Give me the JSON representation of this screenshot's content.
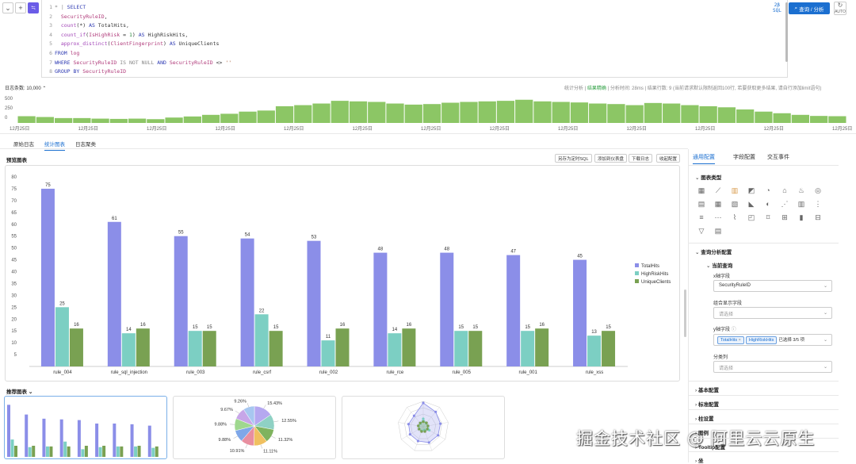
{
  "toolbar": {
    "collapse_icon": "chevron-down-icon",
    "add_icon": "plus-icon",
    "format_icon": "format-icon"
  },
  "editor": {
    "lines": [
      {
        "n": "1",
        "html_kind": "select",
        "text": "SELECT"
      },
      {
        "n": "2",
        "text": "SecurityRuleID,"
      },
      {
        "n": "3",
        "text": "count(*) AS TotalHits,"
      },
      {
        "n": "4",
        "text": "count_if(IsHighRisk = 1) AS HighRiskHits,"
      },
      {
        "n": "5",
        "text": "approx_distinct(ClientFingerprint) AS UniqueClients"
      },
      {
        "n": "6",
        "text": "FROM log"
      },
      {
        "n": "7",
        "text": "WHERE SecurityRuleID IS NOT NULL AND SecurityRuleID <> ''"
      },
      {
        "n": "8",
        "text": "GROUP BY SecurityRuleID"
      }
    ],
    "line1_prefix": "* |",
    "sql_badge_top": "2β",
    "sql_badge_bottom": "SQL"
  },
  "run_button": "查询 / 分析",
  "auto_label": "AUTO",
  "stats": {
    "log_count_label": "日志条数:",
    "log_count_value": "10,000",
    "right": "统计分析  |  结果精确  |  分析时间: 28ms  |  结果行数: 9 (当前请求默认限制返回100行, 若要获取更多结果, 请自行添加limit语句)",
    "right_accent": "结果精确"
  },
  "histogram": {
    "y_ticks": [
      "500",
      "250",
      "0"
    ],
    "x_labels": [
      "12月25日",
      "12月25日",
      "12月25日",
      "12月25日",
      "12月25日",
      "12月25日",
      "12月25日",
      "12月25日",
      "12月25日",
      "12月25日",
      "12月25日",
      "12月25日",
      "12月25日"
    ],
    "values": [
      0.25,
      0.22,
      0.18,
      0.18,
      0.16,
      0.15,
      0.16,
      0.14,
      0.2,
      0.24,
      0.3,
      0.34,
      0.42,
      0.46,
      0.62,
      0.66,
      0.72,
      0.82,
      0.8,
      0.78,
      0.72,
      0.68,
      0.7,
      0.75,
      0.78,
      0.8,
      0.82,
      0.86,
      0.8,
      0.78,
      0.76,
      0.72,
      0.7,
      0.66,
      0.74,
      0.72,
      0.66,
      0.62,
      0.58,
      0.5,
      0.42,
      0.36,
      0.3,
      0.26,
      0.25
    ],
    "color": "#8cc665"
  },
  "tabs": [
    "原始日志",
    "统计图表",
    "日志聚类"
  ],
  "active_tab": 1,
  "preview": {
    "title": "预览图表",
    "buttons": [
      "另存为定时SQL",
      "添加到仪表盘",
      "下载日志",
      "收起配置"
    ]
  },
  "chart_data": {
    "type": "bar",
    "categories": [
      "rule_004",
      "rule_sql_injection",
      "rule_003",
      "rule_csrf",
      "rule_002",
      "rule_rce",
      "rule_005",
      "rule_001",
      "rule_xss"
    ],
    "series": [
      {
        "name": "TotalHits",
        "color": "#8b8ee8",
        "values": [
          75,
          61,
          55,
          54,
          53,
          48,
          48,
          47,
          45
        ]
      },
      {
        "name": "HighRiskHits",
        "color": "#7ccfc3",
        "values": [
          25,
          14,
          15,
          22,
          11,
          14,
          15,
          15,
          13
        ]
      },
      {
        "name": "UniqueClients",
        "color": "#79a152",
        "values": [
          16,
          16,
          15,
          15,
          16,
          16,
          15,
          16,
          15
        ]
      }
    ],
    "ylim": [
      0,
      80
    ],
    "y_ticks": [
      "5",
      "10",
      "15",
      "20",
      "25",
      "30",
      "35",
      "40",
      "45",
      "50",
      "55",
      "60",
      "65",
      "70",
      "75",
      "80"
    ],
    "legend_position": "right",
    "grid": false
  },
  "recommend": {
    "title": "推荐图表",
    "pie_labels": [
      "9.26%",
      "9.67%",
      "9.88%",
      "9.88%",
      "10.91%",
      "11.11%",
      "11.32%",
      "12.55%",
      "15.43%"
    ]
  },
  "right_panel": {
    "tabs": [
      "通用配置",
      "字段配置",
      "交互事件"
    ],
    "active_tab": 0,
    "chart_type_title": "图表类型",
    "query_config_title": "查询分析配置",
    "current_query": "当前查询",
    "x_field_label": "x轴字段",
    "x_field_value": "SecurityRuleID",
    "combo_label": "组合显示字段",
    "combo_placeholder": "请选择",
    "y_field_label": "y轴字段",
    "y_tags": [
      "TotalHits",
      "HighRiskHits"
    ],
    "y_selected": "已选择 3/5 项",
    "series_label": "分类列",
    "series_placeholder": "请选择",
    "sections": [
      "基本配置",
      "标准配置",
      "柱设置",
      "图例",
      "Tooltip配置",
      "坐"
    ]
  },
  "watermark": "掘金技术社区 @ 阿里云云原生"
}
